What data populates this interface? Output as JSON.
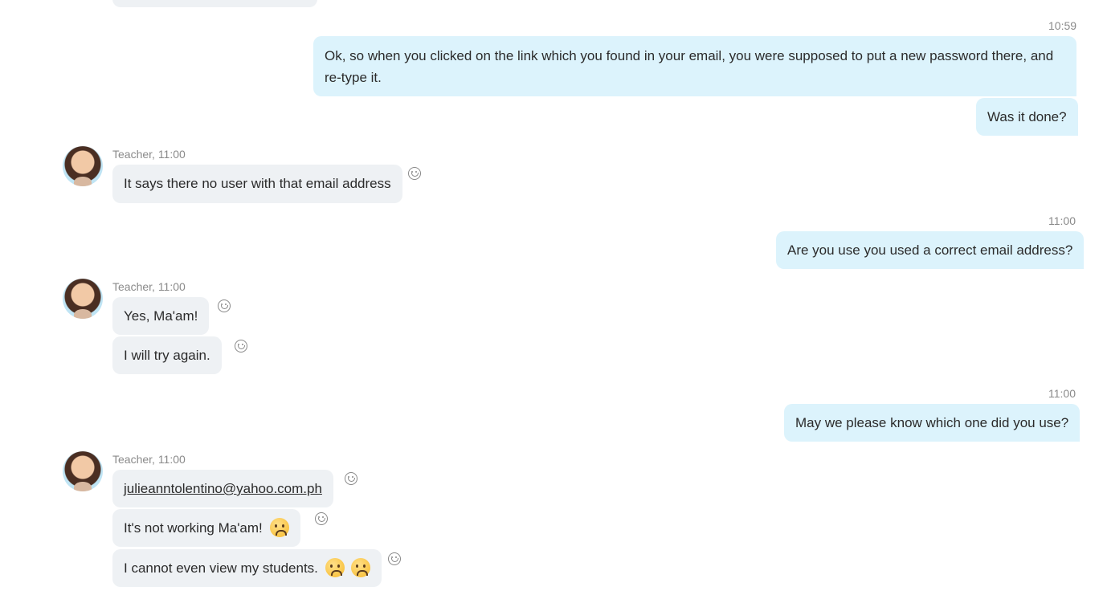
{
  "chat": {
    "time_1059": "10:59",
    "msg_out_1": "Ok, so when you clicked on the link which you found in your email, you were supposed to put a new password there, and re-type it.",
    "msg_out_2": "Was it done?",
    "sender_1": "Teacher, 11:00",
    "msg_in_1": "It says there no user with that email address",
    "time_1100_a": "11:00",
    "msg_out_3": "Are you use you used a correct email address?",
    "sender_2": "Teacher, 11:00",
    "msg_in_2": "Yes, Ma'am!",
    "msg_in_3": "I will try again.",
    "time_1100_b": "11:00",
    "msg_out_4": "May we please know which one did you use?",
    "sender_3": "Teacher, 11:00",
    "msg_in_4": "julieanntolentino@yahoo.com.ph",
    "msg_in_5": "It's not working Ma'am!",
    "msg_in_6": "I cannot even view my students."
  },
  "icons": {
    "reaction": "smiley-outline-icon",
    "sad_emoji": "frowning-face-emoji",
    "anguished_emoji": "anguished-face-emoji"
  },
  "colors": {
    "outgoing_bubble": "#dcf3fc",
    "incoming_bubble": "#eef1f4"
  }
}
